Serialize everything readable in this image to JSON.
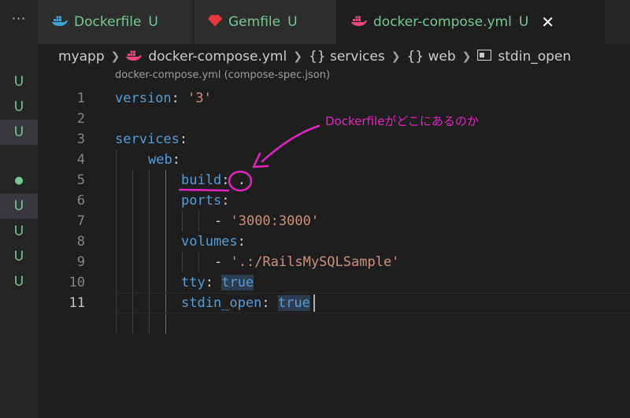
{
  "left": {
    "more_label": "···",
    "marks": [
      "U",
      "U",
      "U",
      "●",
      "U",
      "U",
      "U",
      "U"
    ]
  },
  "tabs": [
    {
      "label": "Dockerfile",
      "status": "U",
      "icon": "docker-icon"
    },
    {
      "label": "Gemfile",
      "status": "U",
      "icon": "ruby-gem-icon"
    },
    {
      "label": "docker-compose.yml",
      "status": "U",
      "icon": "docker-icon",
      "close": "✕"
    }
  ],
  "breadcrumb": {
    "items": [
      "myapp",
      "docker-compose.yml",
      "{} services",
      "{} web",
      "stdin_open"
    ]
  },
  "schema_hint": "docker-compose.yml (compose-spec.json)",
  "code": {
    "line_numbers": [
      "1",
      "2",
      "3",
      "4",
      "5",
      "6",
      "7",
      "8",
      "9",
      "10",
      "11"
    ],
    "l1_key": "version",
    "l1_val": "'3'",
    "l3_key": "services",
    "l4_key": "web",
    "l5_key": "build",
    "l5_val": ".",
    "l6_key": "ports",
    "l7_dash": "- ",
    "l7_val": "'3000:3000'",
    "l8_key": "volumes",
    "l9_dash": "- ",
    "l9_val": "'.:/RailsMySQLSample'",
    "l10_key": "tty",
    "l10_val": "true",
    "l11_key": "stdin_open",
    "l11_val": "true",
    "colon": ":"
  },
  "annotation": {
    "text": "Dockerfileがどこにあるのか",
    "color": "#e324c3"
  },
  "colors": {
    "untracked": "#73c991",
    "keyword": "#569cd6",
    "string": "#ce9178"
  }
}
